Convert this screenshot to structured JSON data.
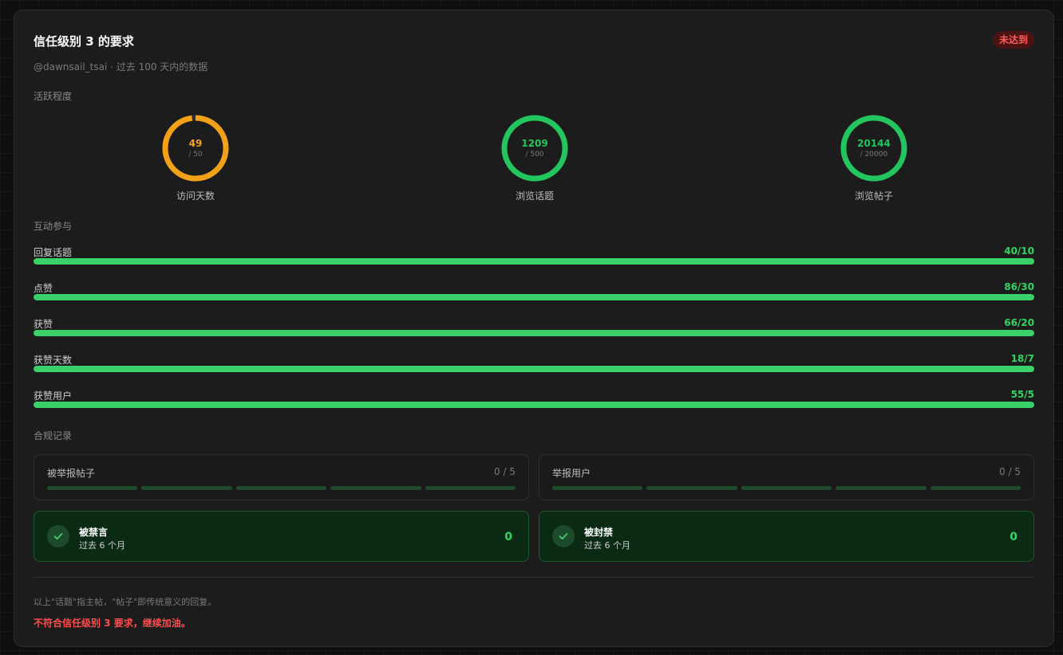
{
  "header": {
    "title": "信任级别 3 的要求",
    "status_badge": "未达到",
    "subtitle": "@dawnsail_tsai · 过去 100 天内的数据"
  },
  "activity": {
    "section_label": "活跃程度",
    "rings": [
      {
        "value": "49",
        "target": "/ 50",
        "label": "访问天数",
        "progress": 0.98,
        "color": "#f3a116"
      },
      {
        "value": "1209",
        "target": "/ 500",
        "label": "浏览话题",
        "progress": 1.0,
        "color": "#22c55e"
      },
      {
        "value": "20144",
        "target": "/ 20000",
        "label": "浏览帖子",
        "progress": 1.0,
        "color": "#22c55e"
      }
    ]
  },
  "engagement": {
    "section_label": "互动参与",
    "bars": [
      {
        "label": "回复话题",
        "value": "40/10",
        "progress": 1.0
      },
      {
        "label": "点赞",
        "value": "86/30",
        "progress": 1.0
      },
      {
        "label": "获赞",
        "value": "66/20",
        "progress": 1.0
      },
      {
        "label": "获赞天数",
        "value": "18/7",
        "progress": 1.0
      },
      {
        "label": "获赞用户",
        "value": "55/5",
        "progress": 1.0
      }
    ]
  },
  "compliance": {
    "section_label": "合规记录",
    "flagged_posts": {
      "label": "被举报帖子",
      "count": "0 / 5",
      "filled": 0,
      "total": 5
    },
    "flagged_by_users": {
      "label": "举报用户",
      "count": "0 / 5",
      "filled": 0,
      "total": 5
    },
    "silenced": {
      "title": "被禁言",
      "period": "过去 6 个月",
      "count": "0"
    },
    "suspended": {
      "title": "被封禁",
      "period": "过去 6 个月",
      "count": "0"
    }
  },
  "footer": {
    "note": "以上\"话题\"指主帖，\"帖子\"即传统意义的回复。",
    "verdict": "不符合信任级别 3 要求，继续加油。"
  }
}
